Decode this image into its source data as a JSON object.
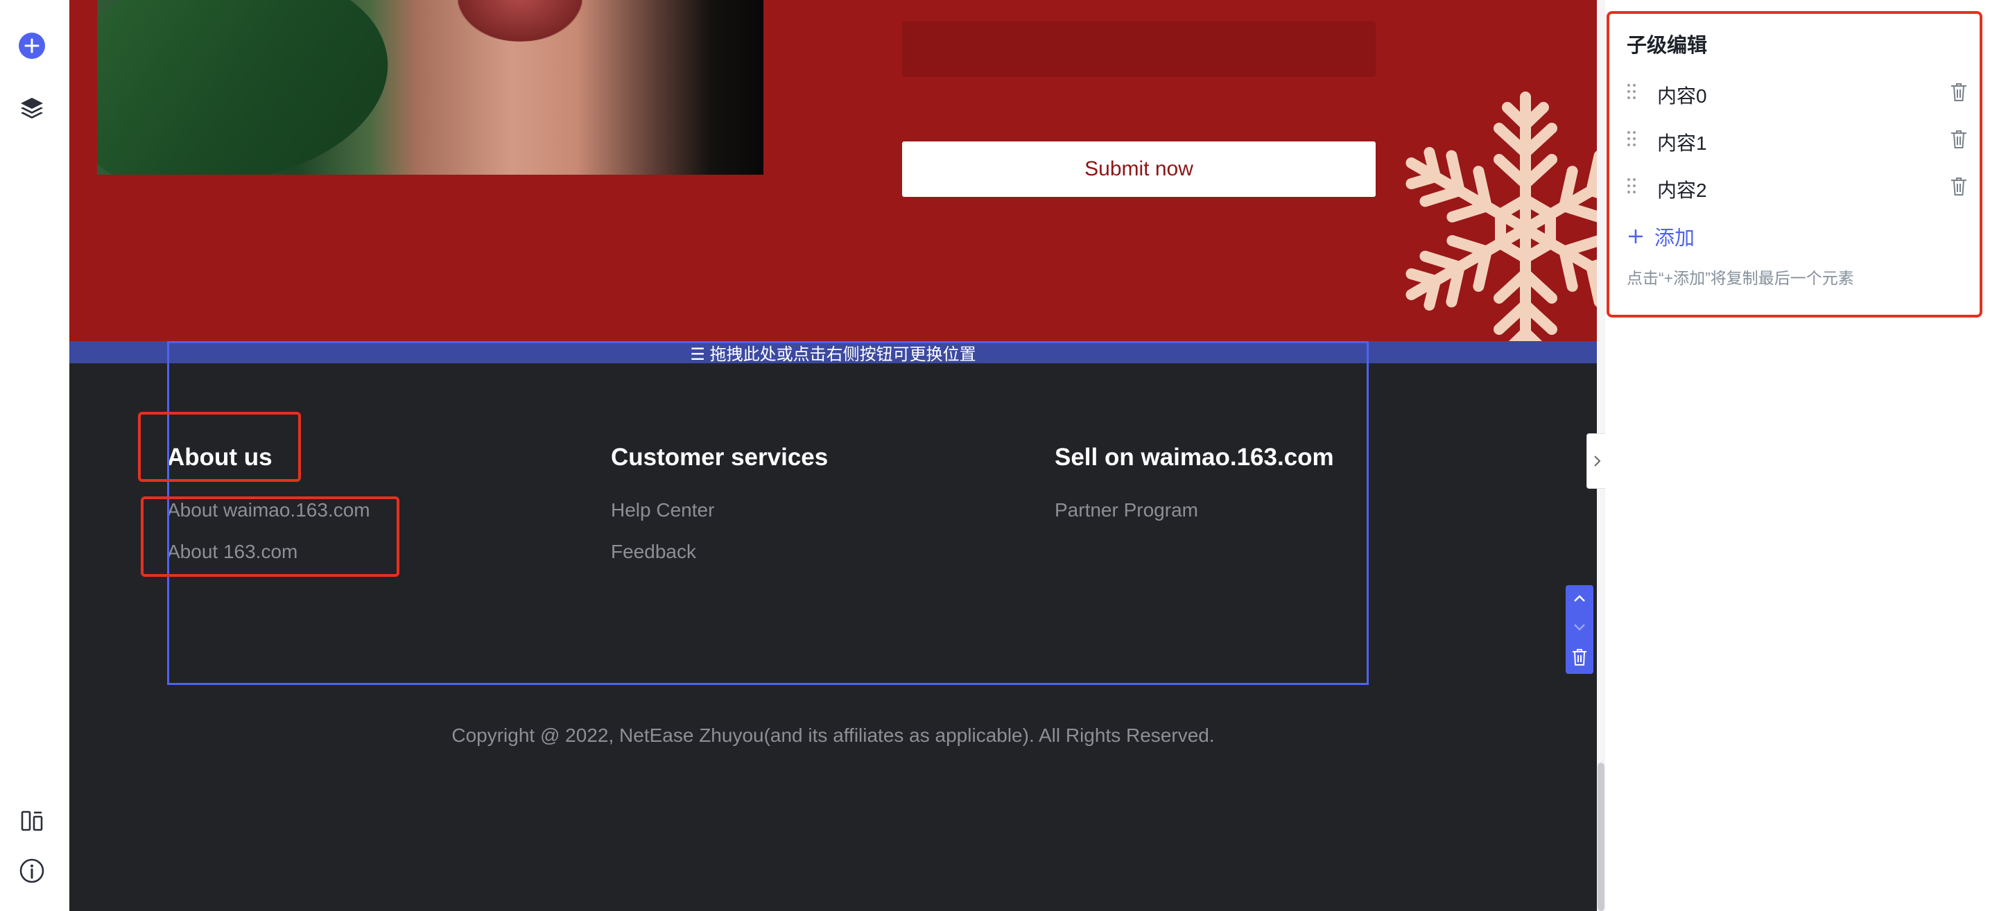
{
  "rail": {
    "icons": [
      "add-icon",
      "layers-icon",
      "layout-icon",
      "info-icon"
    ]
  },
  "hero": {
    "submit_label": "Submit now"
  },
  "drag_bar": {
    "text": "☰ 拖拽此处或点击右侧按钮可更换位置"
  },
  "footer": {
    "columns": [
      {
        "title": "About us",
        "links": [
          "About waimao.163.com",
          "About 163.com"
        ]
      },
      {
        "title": "Customer services",
        "links": [
          "Help Center",
          "Feedback"
        ]
      },
      {
        "title": "Sell on waimao.163.com",
        "links": [
          "Partner Program"
        ]
      }
    ],
    "copyright": "Copyright @ 2022, NetEase Zhuyou(and its affiliates as applicable). All Rights Reserved."
  },
  "panel": {
    "title": "子级编辑",
    "items": [
      "内容0",
      "内容1",
      "内容2"
    ],
    "add_label": "添加",
    "hint": "点击“+添加”将复制最后一个元素"
  },
  "colors": {
    "hero_red": "#9a1818",
    "footer_dark": "#222327",
    "accent_blue": "#4f62ee",
    "highlight_red": "#e5311f",
    "snowflake": "#f3d2bd"
  }
}
